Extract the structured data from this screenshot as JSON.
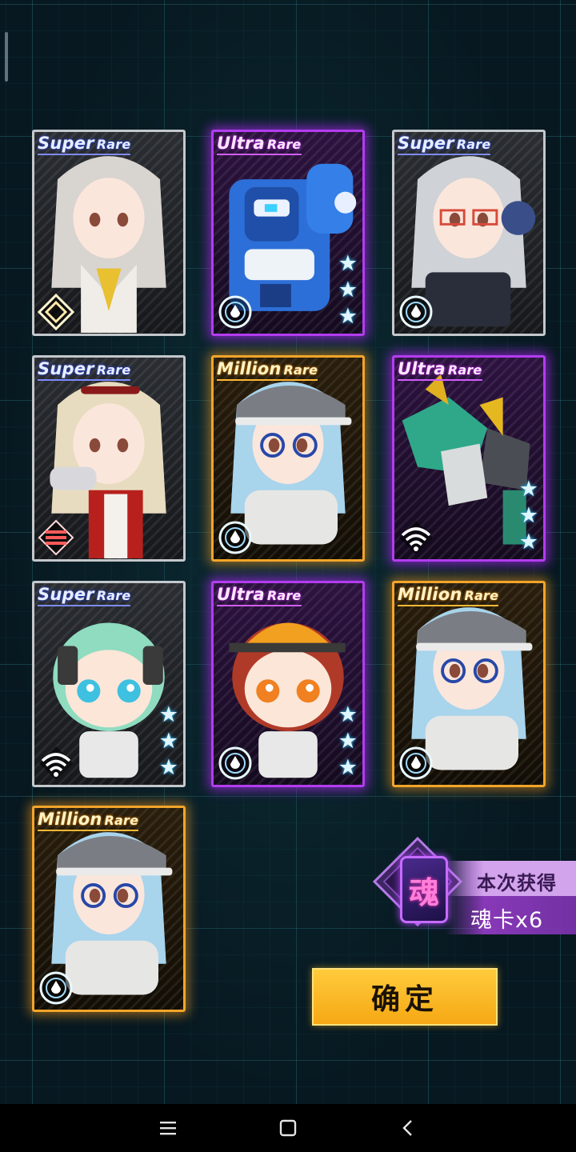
{
  "cards": [
    {
      "rarity": "sr",
      "label_main": "Super",
      "label_sub": "Rare",
      "type_icon": "diamond-emblem-icon",
      "stars": 0,
      "portrait": "silver-haired-sailor-girl"
    },
    {
      "rarity": "ur",
      "label_main": "Ultra",
      "label_sub": "Rare",
      "type_icon": "circle-drop-icon",
      "stars": 3,
      "portrait": "blue-mech-robot"
    },
    {
      "rarity": "sr",
      "label_main": "Super",
      "label_sub": "Rare",
      "type_icon": "circle-drop-icon",
      "stars": 0,
      "portrait": "glasses-girl-headset"
    },
    {
      "rarity": "sr",
      "label_main": "Super",
      "label_sub": "Rare",
      "type_icon": "cross-shield-icon",
      "stars": 0,
      "portrait": "armored-blonde-girl"
    },
    {
      "rarity": "mr",
      "label_main": "Million",
      "label_sub": "Rare",
      "type_icon": "circle-drop-icon",
      "stars": 0,
      "portrait": "helmet-glasses-girl"
    },
    {
      "rarity": "ur",
      "label_main": "Ultra",
      "label_sub": "Rare",
      "type_icon": "wifi-signal-icon",
      "stars": 3,
      "portrait": "green-mech-beast"
    },
    {
      "rarity": "sr",
      "label_main": "Super",
      "label_sub": "Rare",
      "type_icon": "wifi-signal-icon",
      "stars": 3,
      "portrait": "chibi-green-hair-girl"
    },
    {
      "rarity": "ur",
      "label_main": "Ultra",
      "label_sub": "Rare",
      "type_icon": "circle-drop-icon",
      "stars": 3,
      "portrait": "chibi-hardhat-girl"
    },
    {
      "rarity": "mr",
      "label_main": "Million",
      "label_sub": "Rare",
      "type_icon": "circle-drop-icon",
      "stars": 0,
      "portrait": "helmet-glasses-girl"
    },
    {
      "rarity": "mr",
      "label_main": "Million",
      "label_sub": "Rare",
      "type_icon": "circle-drop-icon",
      "stars": 0,
      "portrait": "helmet-glasses-girl"
    }
  ],
  "reward": {
    "title": "本次获得",
    "count": "魂卡x6",
    "card_glyph": "魂"
  },
  "confirm_label": "确定",
  "colors": {
    "super_rare": "#7d8bff",
    "ultra_rare": "#b33cf0",
    "million_rare": "#f2a52a",
    "button": "#f6a814"
  },
  "navbar": {
    "items": [
      "menu-icon",
      "home-square-icon",
      "back-chevron-icon"
    ]
  }
}
